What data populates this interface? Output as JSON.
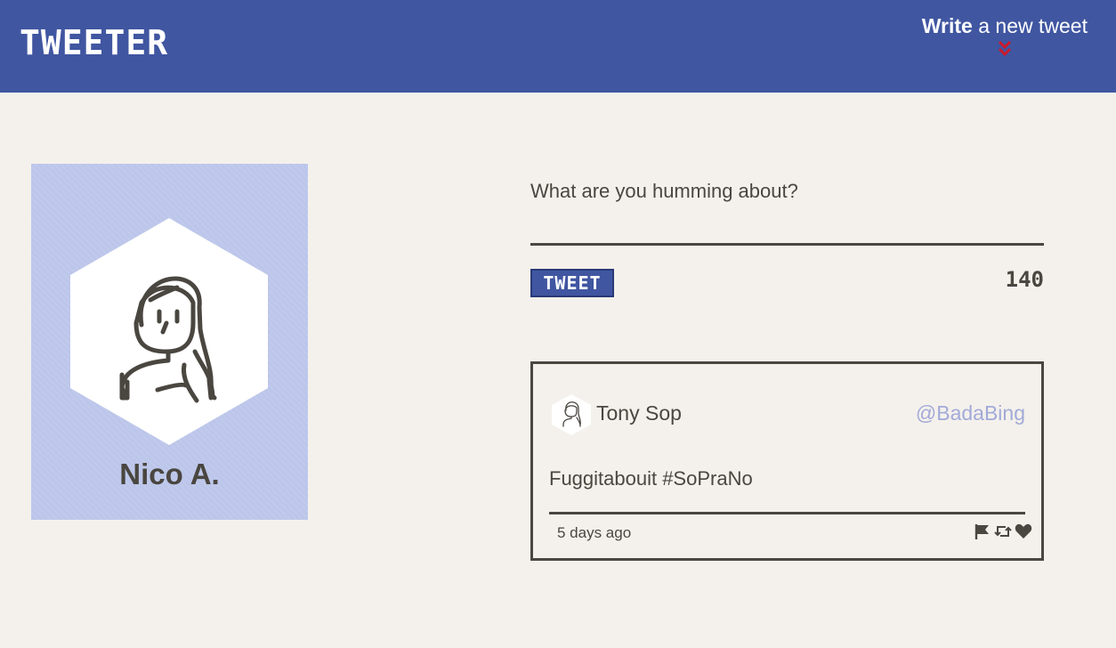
{
  "header": {
    "brand": "Tweeter",
    "compose_bold": "Write",
    "compose_rest": " a new tweet",
    "compose_icon": "double-chevron-down-icon",
    "accent_color": "#cc1a2b",
    "bar_color": "#4056a1"
  },
  "profile": {
    "name": "Nico A.",
    "avatar_icon": "person-avatar-icon",
    "card_color": "#bcc6ea"
  },
  "composer": {
    "placeholder": "What are you humming about?",
    "button_label": "Tweet",
    "char_count": "140"
  },
  "tweets": [
    {
      "name": "Tony Sop",
      "handle": "@BadaBing",
      "body": "Fuggitabouit #SoPraNo",
      "time": "5 days ago",
      "actions": [
        "flag-icon",
        "retweet-icon",
        "heart-icon"
      ]
    }
  ]
}
